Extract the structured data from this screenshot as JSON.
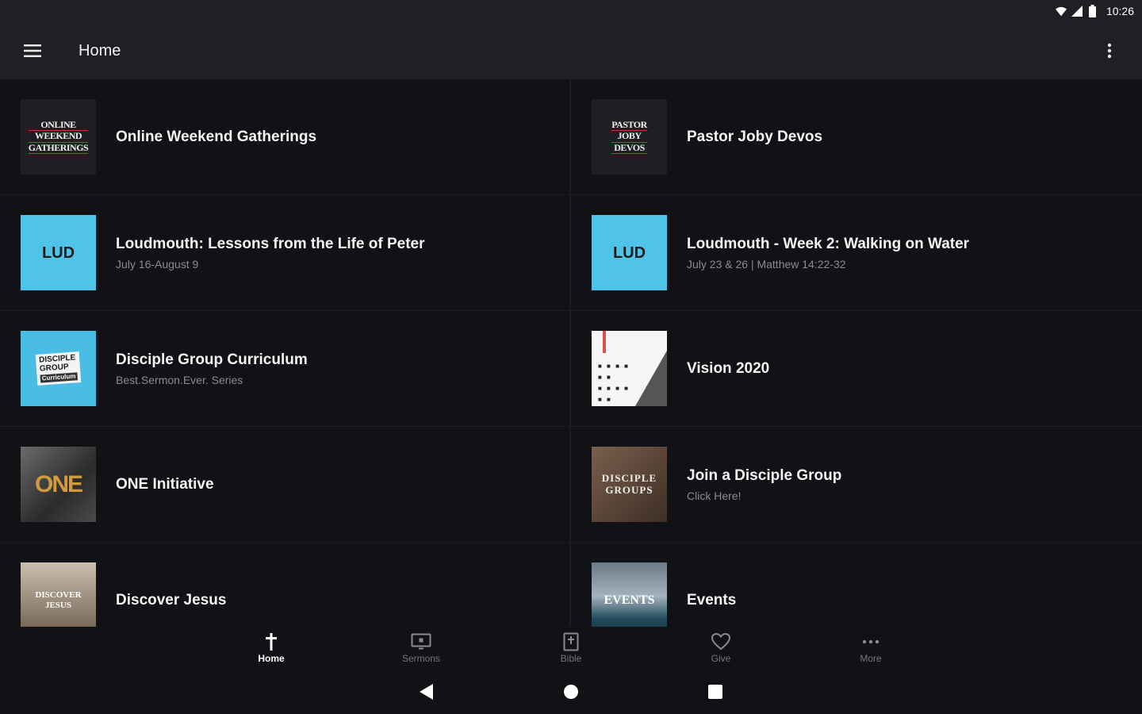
{
  "status_bar": {
    "time": "10:26"
  },
  "app_bar": {
    "title": "Home"
  },
  "items": [
    {
      "title": "Online Weekend Gatherings",
      "subtitle": "",
      "thumb_lines": [
        "ONLINE",
        "WEEKEND",
        "GATHERINGS"
      ]
    },
    {
      "title": "Pastor Joby Devos",
      "subtitle": "",
      "thumb_lines": [
        "PASTOR",
        "JOBY",
        "DEVOS"
      ]
    },
    {
      "title": "Loudmouth: Lessons from the Life of Peter",
      "subtitle": "July 16-August 9",
      "thumb_text": "LUD"
    },
    {
      "title": "Loudmouth - Week 2: Walking on Water",
      "subtitle": "July 23 & 26 | Matthew 14:22-32",
      "thumb_text": "LUD"
    },
    {
      "title": "Disciple Group Curriculum",
      "subtitle": "Best.Sermon.Ever. Series",
      "thumb_lines": [
        "DISCIPLE",
        "GROUP"
      ],
      "thumb_sub": "Curriculum"
    },
    {
      "title": "Vision 2020",
      "subtitle": ""
    },
    {
      "title": "ONE Initiative",
      "subtitle": "",
      "thumb_text": "ONE"
    },
    {
      "title": "Join a Disciple Group",
      "subtitle": "Click Here!",
      "thumb_lines": [
        "DISCIPLE",
        "GROUPS"
      ]
    },
    {
      "title": "Discover Jesus",
      "subtitle": "",
      "thumb_lines": [
        "DISCOVER",
        "JESUS"
      ]
    },
    {
      "title": "Events",
      "subtitle": "",
      "thumb_text": "EVENTS"
    }
  ],
  "bottom_nav": [
    {
      "label": "Home",
      "icon": "cross-icon",
      "active": true
    },
    {
      "label": "Sermons",
      "icon": "tv-icon",
      "active": false
    },
    {
      "label": "Bible",
      "icon": "bible-icon",
      "active": false
    },
    {
      "label": "Give",
      "icon": "heart-icon",
      "active": false
    },
    {
      "label": "More",
      "icon": "more-horizontal-icon",
      "active": false
    }
  ],
  "colors": {
    "background": "#111215",
    "app_bar": "#1f2023",
    "accent_blue": "#4fc3e8",
    "inactive_nav": "#75767b"
  }
}
